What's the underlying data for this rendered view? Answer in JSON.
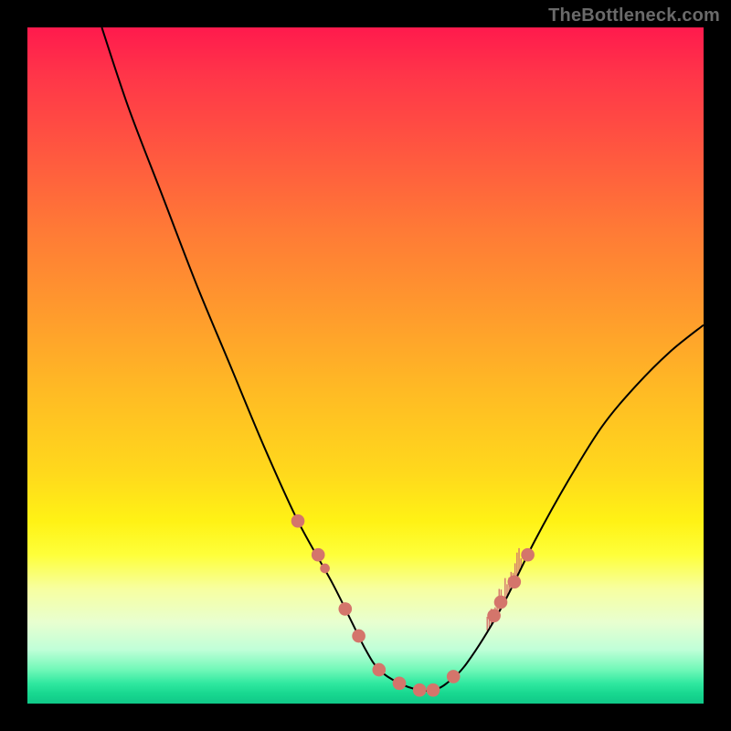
{
  "watermark": "TheBottleneck.com",
  "chart_data": {
    "type": "line",
    "title": "",
    "xlabel": "",
    "ylabel": "",
    "xlim": [
      0,
      100
    ],
    "ylim": [
      0,
      100
    ],
    "grid": false,
    "gradient_stops": [
      {
        "pct": 0,
        "color": "#ff1a4d"
      },
      {
        "pct": 7,
        "color": "#ff3549"
      },
      {
        "pct": 18,
        "color": "#ff5640"
      },
      {
        "pct": 30,
        "color": "#ff7a36"
      },
      {
        "pct": 42,
        "color": "#ff9a2d"
      },
      {
        "pct": 54,
        "color": "#ffbb24"
      },
      {
        "pct": 66,
        "color": "#ffd91c"
      },
      {
        "pct": 73,
        "color": "#fff215"
      },
      {
        "pct": 78,
        "color": "#feff3a"
      },
      {
        "pct": 83,
        "color": "#f7ffa0"
      },
      {
        "pct": 88,
        "color": "#e8ffd0"
      },
      {
        "pct": 92,
        "color": "#c0ffd8"
      },
      {
        "pct": 95,
        "color": "#70f8b8"
      },
      {
        "pct": 97,
        "color": "#30e8a0"
      },
      {
        "pct": 98.5,
        "color": "#18d890"
      },
      {
        "pct": 100,
        "color": "#10c888"
      }
    ],
    "series": [
      {
        "name": "bottleneck-curve",
        "color": "#000000",
        "x": [
          11,
          15,
          20,
          25,
          30,
          35,
          40,
          45,
          48,
          50,
          52,
          55,
          58,
          60,
          62,
          65,
          70,
          75,
          80,
          85,
          90,
          95,
          100
        ],
        "y": [
          100,
          88,
          75,
          62,
          50,
          38,
          27,
          18,
          12,
          8,
          5,
          3,
          2,
          2,
          3,
          6,
          14,
          24,
          33,
          41,
          47,
          52,
          56
        ]
      }
    ],
    "markers": [
      {
        "name": "highlight-left-a",
        "color": "#d4756b",
        "x": 40,
        "y": 27,
        "r": 2.2
      },
      {
        "name": "highlight-left-b",
        "color": "#d4756b",
        "x": 43,
        "y": 22,
        "r": 2.2
      },
      {
        "name": "highlight-left-c",
        "color": "#d4756b",
        "x": 44,
        "y": 20,
        "r": 1.6
      },
      {
        "name": "highlight-left-d",
        "color": "#d4756b",
        "x": 47,
        "y": 14,
        "r": 2.2
      },
      {
        "name": "highlight-left-e",
        "color": "#d4756b",
        "x": 49,
        "y": 10,
        "r": 2.2
      },
      {
        "name": "highlight-bottom-a",
        "color": "#d4756b",
        "x": 52,
        "y": 5,
        "r": 2.2
      },
      {
        "name": "highlight-bottom-b",
        "color": "#d4756b",
        "x": 55,
        "y": 3,
        "r": 2.2
      },
      {
        "name": "highlight-bottom-c",
        "color": "#d4756b",
        "x": 58,
        "y": 2,
        "r": 2.2
      },
      {
        "name": "highlight-bottom-d",
        "color": "#d4756b",
        "x": 60,
        "y": 2,
        "r": 2.2
      },
      {
        "name": "highlight-bottom-e",
        "color": "#d4756b",
        "x": 63,
        "y": 4,
        "r": 2.2
      },
      {
        "name": "highlight-right-a",
        "color": "#d4756b",
        "x": 69,
        "y": 13,
        "r": 2.2
      },
      {
        "name": "highlight-right-b",
        "color": "#d4756b",
        "x": 70,
        "y": 15,
        "r": 2.2
      },
      {
        "name": "highlight-right-c",
        "color": "#d4756b",
        "x": 72,
        "y": 18,
        "r": 2.2
      },
      {
        "name": "highlight-right-d",
        "color": "#d4756b",
        "x": 74,
        "y": 22,
        "r": 2.2
      }
    ],
    "spikes": {
      "name": "green-spikes",
      "color": "#d4756b",
      "x_range": [
        68,
        73
      ],
      "y_base_approx": 14,
      "height_approx": 3
    }
  }
}
